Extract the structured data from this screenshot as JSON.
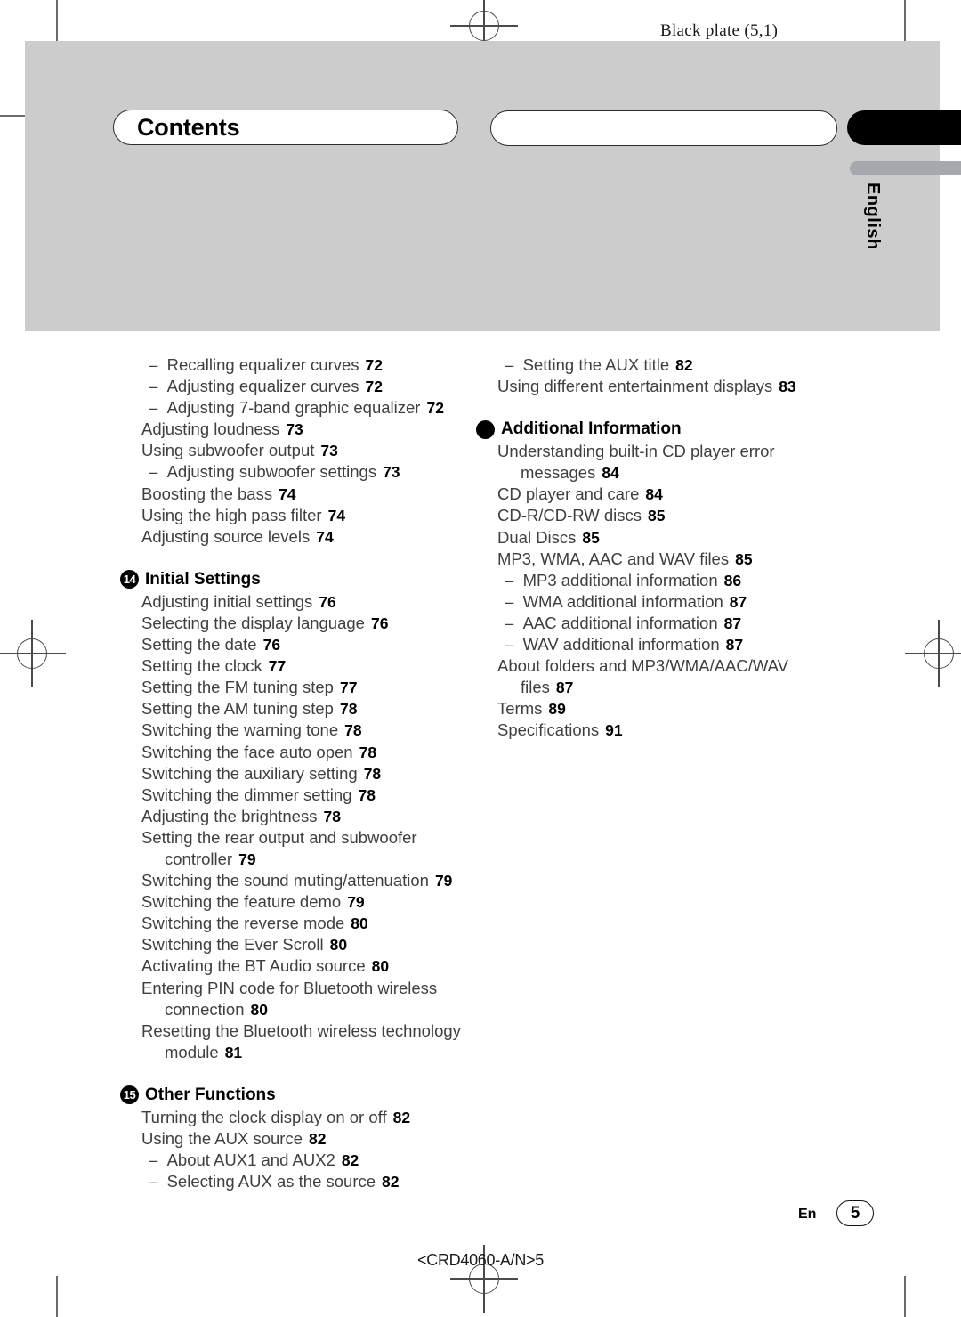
{
  "document": {
    "plate_caption": "Black plate (5,1)",
    "header_title": "Contents",
    "language_tab": "English",
    "footer_language": "En",
    "footer_page_number": "5",
    "footer_code": "<CRD4060-A/N>5"
  },
  "colors": {
    "panel_gray": "#cccccc",
    "accent_gray": "#a5a9ad",
    "tab_black": "#000000",
    "body_text": "#3f3f3f",
    "page_number_text": "#000000"
  },
  "left_column": {
    "entries": [
      {
        "dash": true,
        "text": "Recalling equalizer curves",
        "page": "72"
      },
      {
        "dash": true,
        "text": "Adjusting equalizer curves",
        "page": "72"
      },
      {
        "dash": true,
        "text": "Adjusting 7-band graphic equalizer",
        "page": "72"
      },
      {
        "dash": false,
        "text": "Adjusting loudness",
        "page": "73"
      },
      {
        "dash": false,
        "text": "Using subwoofer output",
        "page": "73"
      },
      {
        "dash": true,
        "text": "Adjusting subwoofer settings",
        "page": "73"
      },
      {
        "dash": false,
        "text": "Boosting the bass",
        "page": "74"
      },
      {
        "dash": false,
        "text": "Using the high pass filter",
        "page": "74"
      },
      {
        "dash": false,
        "text": "Adjusting source levels",
        "page": "74"
      }
    ],
    "chapter_14": {
      "badge": "14",
      "title": "Initial Settings",
      "entries": [
        {
          "dash": false,
          "text": "Adjusting initial settings",
          "page": "76"
        },
        {
          "dash": false,
          "text": "Selecting the display language",
          "page": "76"
        },
        {
          "dash": false,
          "text": "Setting the date",
          "page": "76"
        },
        {
          "dash": false,
          "text": "Setting the clock",
          "page": "77"
        },
        {
          "dash": false,
          "text": "Setting the FM tuning step",
          "page": "77"
        },
        {
          "dash": false,
          "text": "Setting the AM tuning step",
          "page": "78"
        },
        {
          "dash": false,
          "text": "Switching the warning tone",
          "page": "78"
        },
        {
          "dash": false,
          "text": "Switching the face auto open",
          "page": "78"
        },
        {
          "dash": false,
          "text": "Switching the auxiliary setting",
          "page": "78"
        },
        {
          "dash": false,
          "text": "Switching the dimmer setting",
          "page": "78"
        },
        {
          "dash": false,
          "text": "Adjusting the brightness",
          "page": "78"
        },
        {
          "dash": false,
          "text": "Setting the rear output and subwoofer",
          "continuation": "controller",
          "page": "79"
        },
        {
          "dash": false,
          "text": "Switching the sound muting/attenuation",
          "page": "79"
        },
        {
          "dash": false,
          "text": "Switching the feature demo",
          "page": "79"
        },
        {
          "dash": false,
          "text": "Switching the reverse mode",
          "page": "80"
        },
        {
          "dash": false,
          "text": "Switching the Ever Scroll",
          "page": "80"
        },
        {
          "dash": false,
          "text": "Activating the BT Audio source",
          "page": "80"
        },
        {
          "dash": false,
          "text": "Entering PIN code for Bluetooth wireless",
          "continuation": "connection",
          "page": "80"
        },
        {
          "dash": false,
          "text": "Resetting the Bluetooth wireless technology",
          "continuation": "module",
          "page": "81"
        }
      ]
    },
    "chapter_15": {
      "badge": "15",
      "title": "Other Functions",
      "entries": [
        {
          "dash": false,
          "text": "Turning the clock display on or off",
          "page": "82"
        },
        {
          "dash": false,
          "text": "Using the AUX source",
          "page": "82"
        },
        {
          "dash": true,
          "text": "About AUX1 and AUX2",
          "page": "82"
        },
        {
          "dash": true,
          "text": "Selecting AUX as the source",
          "page": "82"
        }
      ]
    }
  },
  "right_column": {
    "entries": [
      {
        "dash": true,
        "text": "Setting the AUX title",
        "page": "82"
      },
      {
        "dash": false,
        "text": "Using different entertainment displays",
        "page": "83"
      }
    ],
    "chapter_additional": {
      "badge": "",
      "title": "Additional Information",
      "entries": [
        {
          "dash": false,
          "text": "Understanding built-in CD player error",
          "continuation": "messages",
          "page": "84"
        },
        {
          "dash": false,
          "text": "CD player and care",
          "page": "84"
        },
        {
          "dash": false,
          "text": "CD-R/CD-RW discs",
          "page": "85"
        },
        {
          "dash": false,
          "text": "Dual Discs",
          "page": "85"
        },
        {
          "dash": false,
          "text": "MP3, WMA, AAC and WAV files",
          "page": "85"
        },
        {
          "dash": true,
          "text": "MP3 additional information",
          "page": "86"
        },
        {
          "dash": true,
          "text": "WMA additional information",
          "page": "87"
        },
        {
          "dash": true,
          "text": "AAC additional information",
          "page": "87"
        },
        {
          "dash": true,
          "text": "WAV additional information",
          "page": "87"
        },
        {
          "dash": false,
          "text": "About folders and MP3/WMA/AAC/WAV",
          "continuation": "files",
          "page": "87"
        },
        {
          "dash": false,
          "text": "Terms",
          "page": "89"
        },
        {
          "dash": false,
          "text": "Specifications",
          "page": "91"
        }
      ]
    }
  }
}
